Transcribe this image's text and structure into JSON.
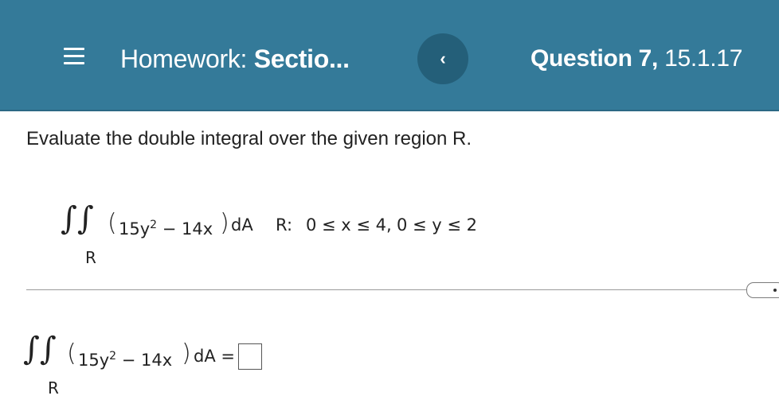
{
  "header": {
    "menu_icon": "hamburger-menu-icon",
    "title_prefix": "Homework:",
    "title_section": "Sectio...",
    "back_icon": "chevron-left-icon",
    "back_glyph": "‹",
    "question_prefix": "Question 7,",
    "question_number": "15.1.17",
    "background_color": "#347a99"
  },
  "problem": {
    "prompt": "Evaluate the double integral over the given region R.",
    "integral_symbol": "∬",
    "integrand": "15y² − 14x",
    "integrand_base": "15y",
    "integrand_exp": "2",
    "integrand_rest": " − 14x",
    "differential": "dA",
    "region_sub": "R",
    "region_label": "R:",
    "region_x": "0 ≤ x ≤ 4,",
    "region_y": "0 ≤ y ≤ 2"
  },
  "answer": {
    "integrand_base": "15y",
    "integrand_exp": "2",
    "integrand_rest": " − 14x",
    "differential": "dA =",
    "region_sub": "R",
    "input_value": ""
  }
}
